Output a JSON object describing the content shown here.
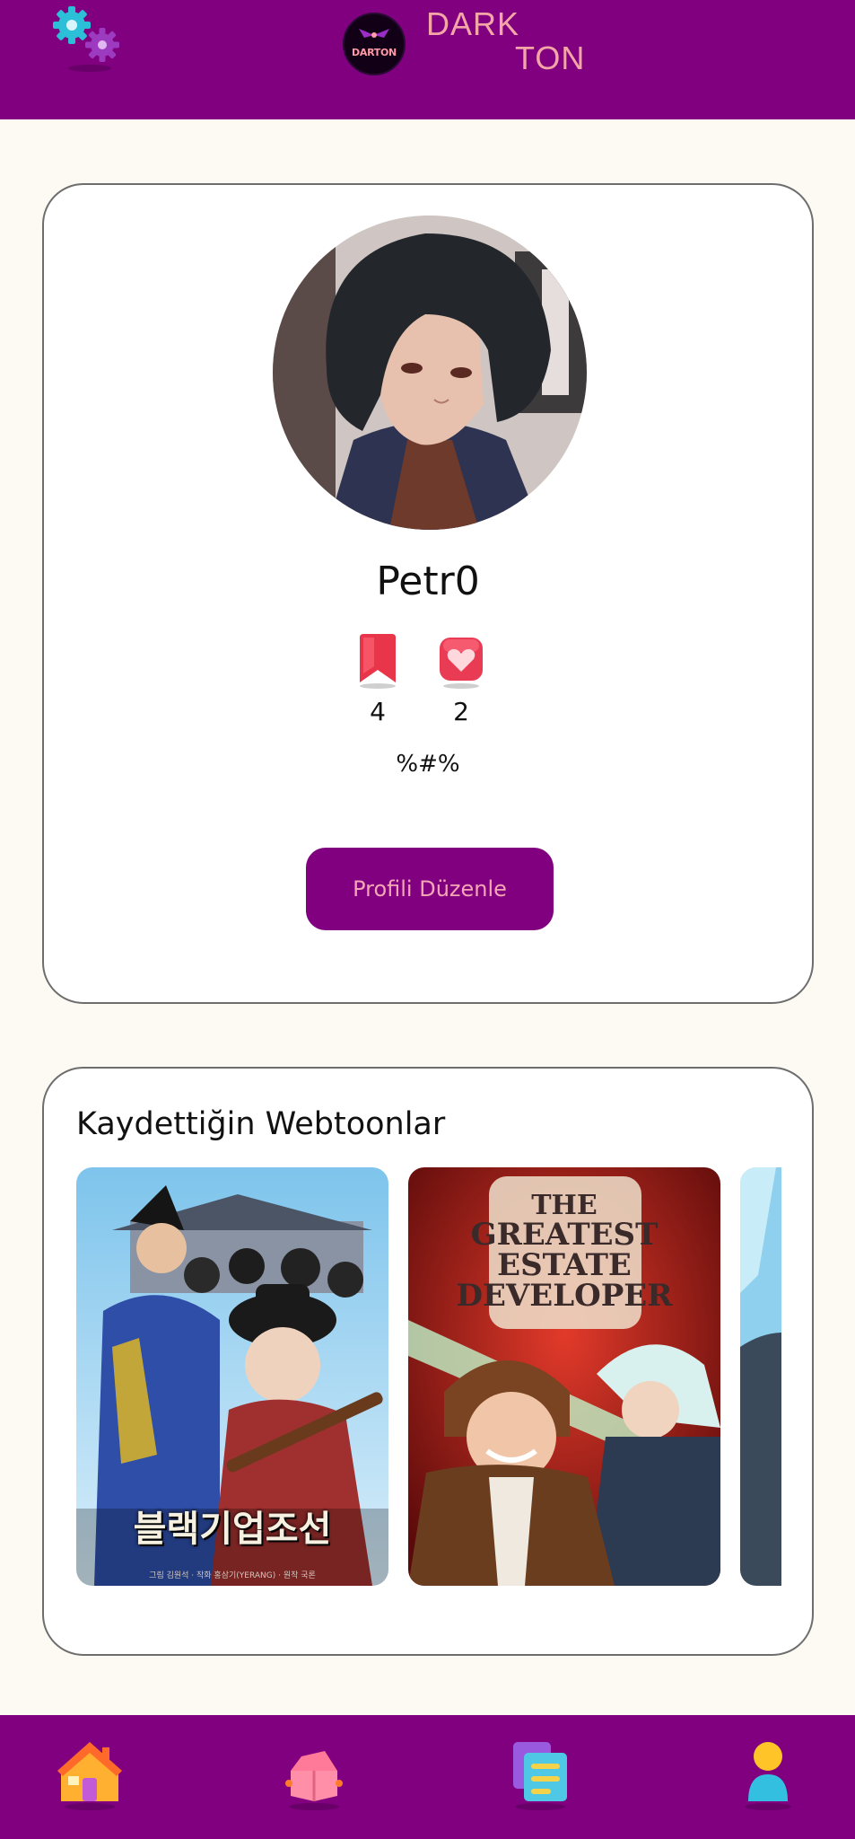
{
  "header": {
    "logo_badge_text": "DARTON",
    "logo_line1": "DARK",
    "logo_line2": "TON",
    "settings_icon": "gears-icon"
  },
  "profile": {
    "username": "Petr0",
    "bookmarks_count": "4",
    "likes_count": "2",
    "bio": "%#%",
    "edit_button_label": "Profili Düzenle"
  },
  "saved": {
    "title": "Kaydettiğin Webtoonlar",
    "covers": [
      {
        "caption": "블랙기업조선",
        "subcaption": "그림 김원석 · 작화 홍삼기(YERANG) · 원작 국론"
      },
      {
        "title_line1": "THE",
        "title_line2": "GREATEST",
        "title_line3": "ESTATE",
        "title_line4": "DEVELOPER"
      },
      {
        "caption": ""
      }
    ]
  },
  "nav": {
    "items": [
      "home-icon",
      "library-icon",
      "list-icon",
      "profile-icon"
    ]
  },
  "colors": {
    "primary": "#800080",
    "accent": "#f4a6b4",
    "background": "#fdf9f3",
    "bookmark": "#e8354a"
  }
}
